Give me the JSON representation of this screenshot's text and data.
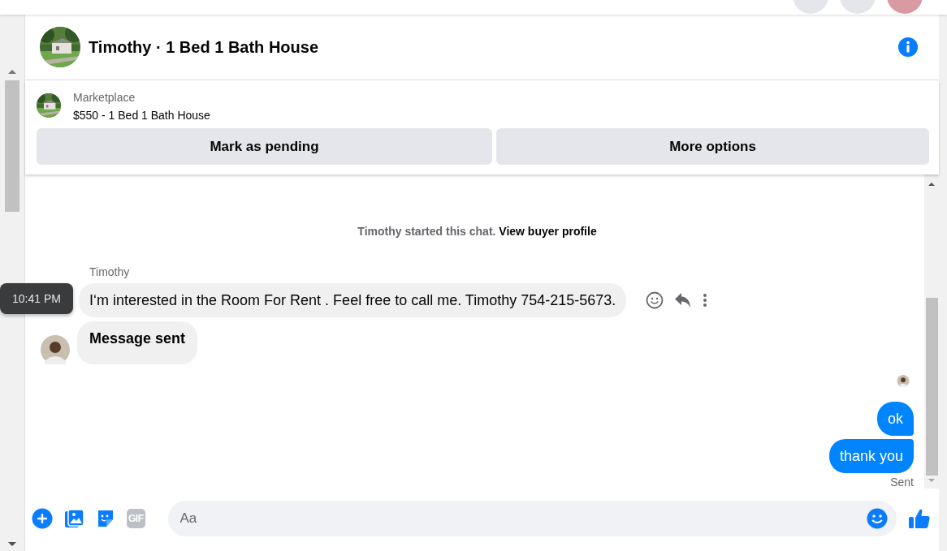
{
  "conversation": {
    "title": "Timothy · 1 Bed 1 Bath House"
  },
  "listing": {
    "label": "Marketplace",
    "title": "$550 - 1 Bed 1 Bath House"
  },
  "actions": [
    "Mark as pending",
    "More options"
  ],
  "notice": {
    "text": "Timothy started this chat.",
    "link": "View buyer profile"
  },
  "messages": [
    {
      "kind": "incoming",
      "sender": "Timothy",
      "text": "I‘m interested in the Room For Rent . Feel free to call me. Timothy 754-215-5673.",
      "timestamp": "10:41 PM"
    },
    {
      "kind": "event",
      "text": "Message sent"
    },
    {
      "kind": "outgoing",
      "text": "ok"
    },
    {
      "kind": "outgoing",
      "text": "thank you"
    }
  ],
  "status": "Sent",
  "composer": {
    "placeholder": "Aa",
    "gif": "GIF"
  }
}
